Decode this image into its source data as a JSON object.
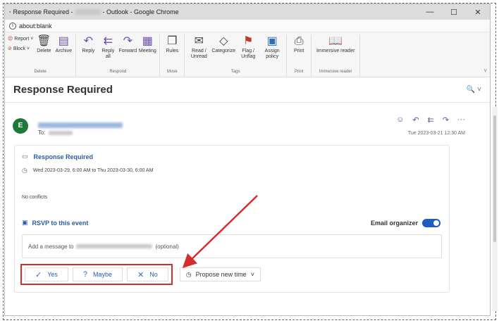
{
  "window": {
    "title_prefix": "Response Required -",
    "title_suffix": "- Outlook - Google Chrome",
    "minimize": "—",
    "maximize": "☐",
    "close": "✕"
  },
  "address": {
    "url": "about:blank"
  },
  "ribbon": {
    "report": "Report",
    "block": "Block",
    "delete": "Delete",
    "archive": "Archive",
    "delete_group": "Delete",
    "reply": "Reply",
    "reply_all": "Reply all",
    "forward": "Forward",
    "meeting": "Meeting",
    "respond_group": "Respond",
    "rules": "Rules",
    "move_group": "Move",
    "read_unread": "Read / Unread",
    "categorize": "Categorize",
    "flag_unflag": "Flag / Unflag",
    "assign_policy": "Assign policy",
    "tags_group": "Tags",
    "print": "Print",
    "print_group": "Print",
    "immersive_reader": "Immersive reader",
    "immersive_group": "Immersive reader"
  },
  "mail": {
    "subject": "Response Required",
    "avatar_letter": "E",
    "to_label": "To:",
    "date": "Tue 2023-03-21 12:30 AM"
  },
  "event": {
    "title": "Response Required",
    "time": "Wed 2023-03-29, 6:00 AM to Thu 2023-03-30, 6:00 AM",
    "conflicts": "No conflicts",
    "rsvp_label": "RSVP to this event",
    "email_organizer": "Email organizer",
    "email_organizer_on": true,
    "message_prefix": "Add a message to",
    "message_suffix": "(optional)",
    "yes": "Yes",
    "maybe": "Maybe",
    "no": "No",
    "propose": "Propose new time"
  }
}
